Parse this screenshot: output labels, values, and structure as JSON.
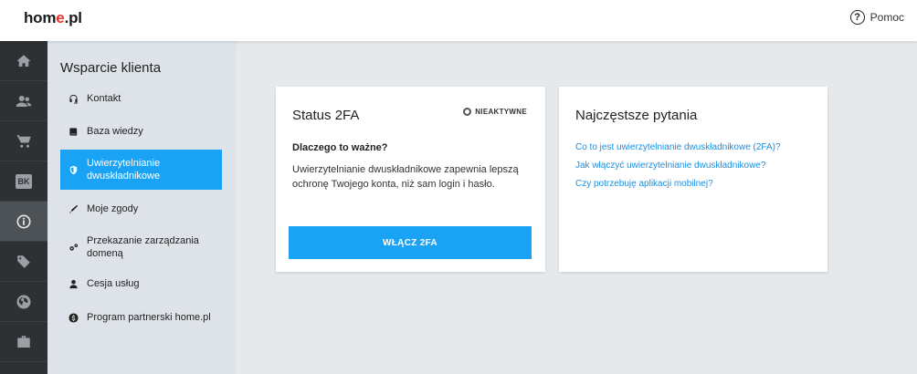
{
  "header": {
    "logo_prefix": "hom",
    "logo_accent": "e",
    "logo_suffix": ".pl",
    "help_label": "Pomoc",
    "help_icon": "question-circle-icon"
  },
  "rail": {
    "items": [
      {
        "icon": "home-icon",
        "active": false
      },
      {
        "icon": "users-icon",
        "active": false
      },
      {
        "icon": "cart-icon",
        "active": false
      },
      {
        "icon": "bk-icon",
        "active": false,
        "text": "BK"
      },
      {
        "icon": "info-icon",
        "active": true
      },
      {
        "icon": "tag-icon",
        "active": false
      },
      {
        "icon": "globe-icon",
        "active": false
      },
      {
        "icon": "briefcase-icon",
        "active": false
      }
    ]
  },
  "sidebar": {
    "title": "Wsparcie klienta",
    "items": [
      {
        "label": "Kontakt",
        "icon": "headset-icon",
        "active": false
      },
      {
        "label": "Baza wiedzy",
        "icon": "book-icon",
        "active": false
      },
      {
        "label": "Uwierzytelnianie dwuskładnikowe",
        "icon": "shield-icon",
        "active": true
      },
      {
        "label": "Moje zgody",
        "icon": "pen-icon",
        "active": false
      },
      {
        "label": "Przekazanie zarządzania domeną",
        "icon": "gears-icon",
        "active": false
      },
      {
        "label": "Cesja usług",
        "icon": "user-icon",
        "active": false
      },
      {
        "label": "Program partnerski home.pl",
        "icon": "dollar-icon",
        "active": false
      }
    ]
  },
  "card_2fa": {
    "title": "Status 2FA",
    "status": "NIEAKTYWNE",
    "why_heading": "Dlaczego to ważne?",
    "description": "Uwierzytelnianie dwuskładnikowe zapewnia lepszą ochronę Twojego konta, niż sam login i hasło.",
    "button_label": "WŁĄCZ 2FA",
    "accent_color": "#1aa3f5"
  },
  "card_faq": {
    "title": "Najczęstsze pytania",
    "links": [
      "Co to jest uwierzytelnianie dwuskładnikowe (2FA)?",
      "Jak włączyć uwierzytelnianie dwuskładnikowe?",
      "Czy potrzebuję aplikacji mobilnej?"
    ],
    "link_color": "#1a8fe0"
  }
}
